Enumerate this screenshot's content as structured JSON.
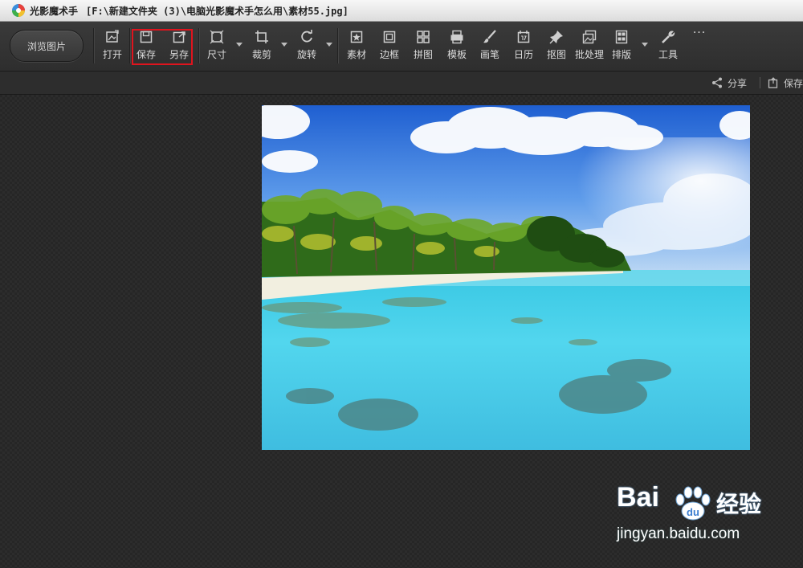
{
  "window": {
    "app_name": "光影魔术手",
    "file_path": "[F:\\新建文件夹 (3)\\电脑光影魔术手怎么用\\素材55.jpg]"
  },
  "toolbar": {
    "browse_label": "浏览图片",
    "tools": {
      "open": "打开",
      "save": "保存",
      "save_as": "另存",
      "size": "尺寸",
      "crop": "裁剪",
      "rotate": "旋转",
      "material": "素材",
      "border": "边框",
      "collage": "拼图",
      "template": "模板",
      "brush": "画笔",
      "calendar": "日历",
      "cutout": "抠图",
      "batch": "批处理",
      "layout": "排版",
      "tools": "工具"
    },
    "more_label": "···"
  },
  "subbar": {
    "share_label": "分享",
    "save_label": "保存"
  },
  "watermark": {
    "brand": "Bai",
    "brand_cn": "经验",
    "url": "jingyan.baidu.com"
  },
  "colors": {
    "highlight": "#e0141e",
    "toolbar_bg": "#333333",
    "canvas_bg": "#262626"
  },
  "icons": [
    "app-logo-icon",
    "open-icon",
    "save-icon",
    "save-as-icon",
    "size-icon",
    "crop-icon",
    "rotate-icon",
    "material-icon",
    "border-icon",
    "collage-icon",
    "template-icon",
    "brush-icon",
    "calendar-icon",
    "cutout-icon",
    "batch-icon",
    "layout-icon",
    "tools-icon",
    "more-icon",
    "share-icon",
    "save-small-icon"
  ]
}
